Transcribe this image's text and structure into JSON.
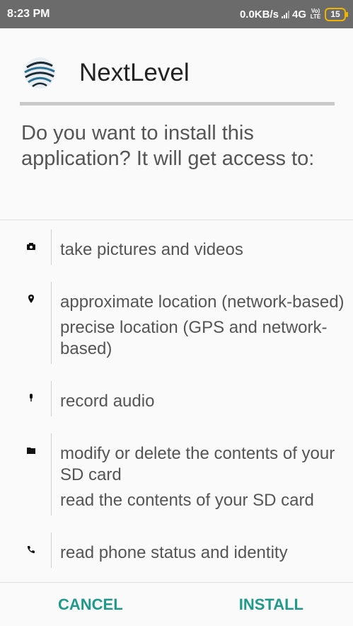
{
  "status_bar": {
    "time": "8:23 PM",
    "network_speed": "0.0KB/s",
    "network_type": "4G",
    "volte_top": "Vo)",
    "volte_bottom": "LTE",
    "battery": "15"
  },
  "app": {
    "name": "NextLevel",
    "icon": "nextlevel-logo-icon"
  },
  "prompt": "Do you want to install this application? It will get access to:",
  "permissions": [
    {
      "icon": "camera-icon",
      "lines": [
        "take pictures and videos"
      ]
    },
    {
      "icon": "location-pin-icon",
      "lines": [
        "approximate location (network-based)",
        "precise location (GPS and network-based)"
      ]
    },
    {
      "icon": "microphone-icon",
      "lines": [
        "record audio"
      ]
    },
    {
      "icon": "folder-icon",
      "lines": [
        "modify or delete the contents of your SD card",
        "read the contents of your SD card"
      ]
    },
    {
      "icon": "phone-icon",
      "lines": [
        "read phone status and identity"
      ]
    }
  ],
  "actions": {
    "cancel": "CANCEL",
    "install": "INSTALL"
  },
  "colors": {
    "accent": "#1f9a8a",
    "status_bar": "#6b6b6b",
    "battery": "#f0b400"
  }
}
